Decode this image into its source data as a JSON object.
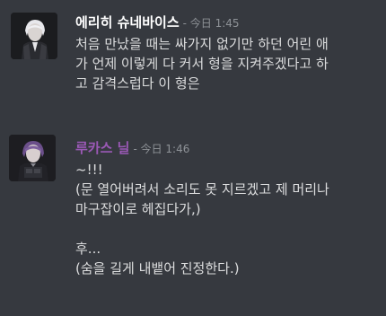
{
  "messages": [
    {
      "username": "에리히 슈네바이스",
      "timestamp": "- 今日 1:45",
      "lines": [
        "처음 만났을 때는 싸가지 없기만 하던 어린 애",
        "가 언제 이렇게 다 커서 형을 지켜주겠다고 하",
        "고 감격스럽다 이 형은"
      ],
      "name_color": "#ffffff"
    },
    {
      "username": "루카스 닐",
      "timestamp": "- 今日 1:46",
      "lines": [
        "~!!!",
        "(문 열어버려서 소리도 못 지르겠고 제 머리나",
        "마구잡이로 헤집다가,)",
        "",
        "후...",
        "(숨을 길게 내뱉어 진정한다.)"
      ],
      "name_color": "#9b59b6"
    }
  ],
  "colors": {
    "background": "#36393f",
    "text": "#dcddde",
    "timestamp": "#8e9297"
  },
  "icons": [
    "avatar-erich",
    "avatar-lucas"
  ]
}
